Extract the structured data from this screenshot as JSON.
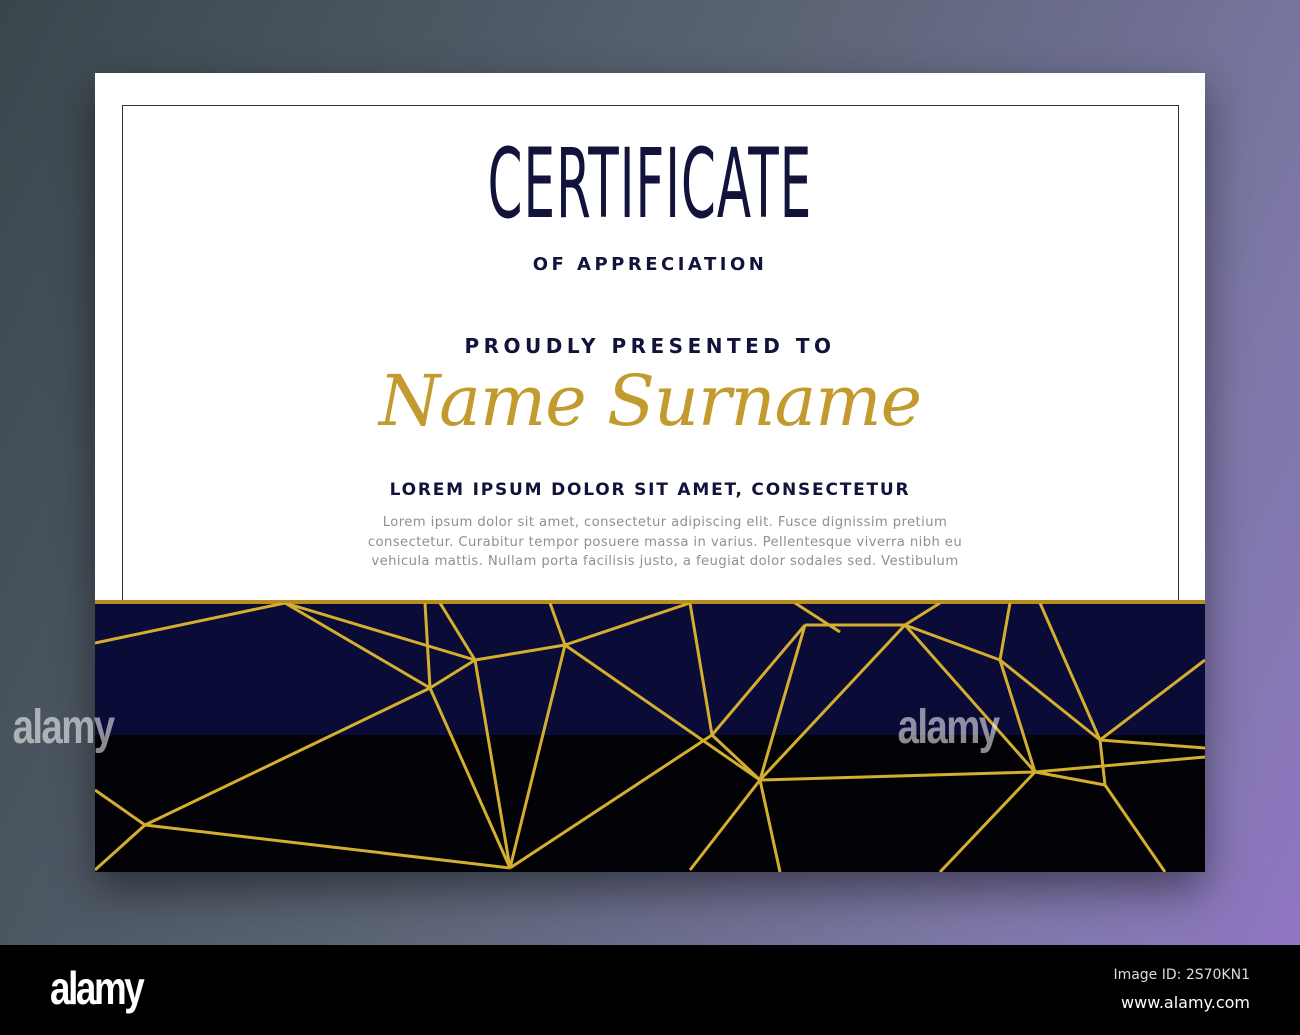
{
  "certificate": {
    "title": "CERTIFICATE",
    "subtitle": "OF APPRECIATION",
    "presented_to": "PROUDLY PRESENTED TO",
    "recipient_name": "Name Surname",
    "tagline": "LOREM IPSUM DOLOR SIT AMET, CONSECTETUR",
    "body_lines": [
      "Lorem ipsum dolor sit amet, consectetur adipiscing elit. Fusce dignissim pretium",
      "consectetur. Curabitur tempor posuere massa in varius. Pellentesque viverra nibh eu",
      "vehicula mattis. Nullam porta facilisis justo, a feugiat dolor sodales sed. Vestibulum"
    ]
  },
  "colors": {
    "gold": "#c39a2d",
    "navy": "#0a0b36",
    "ink": "#12133a"
  },
  "watermark": "alamy",
  "footer": {
    "logo": "alamy",
    "image_id": "Image ID: 2S70KN1",
    "url": "www.alamy.com"
  }
}
